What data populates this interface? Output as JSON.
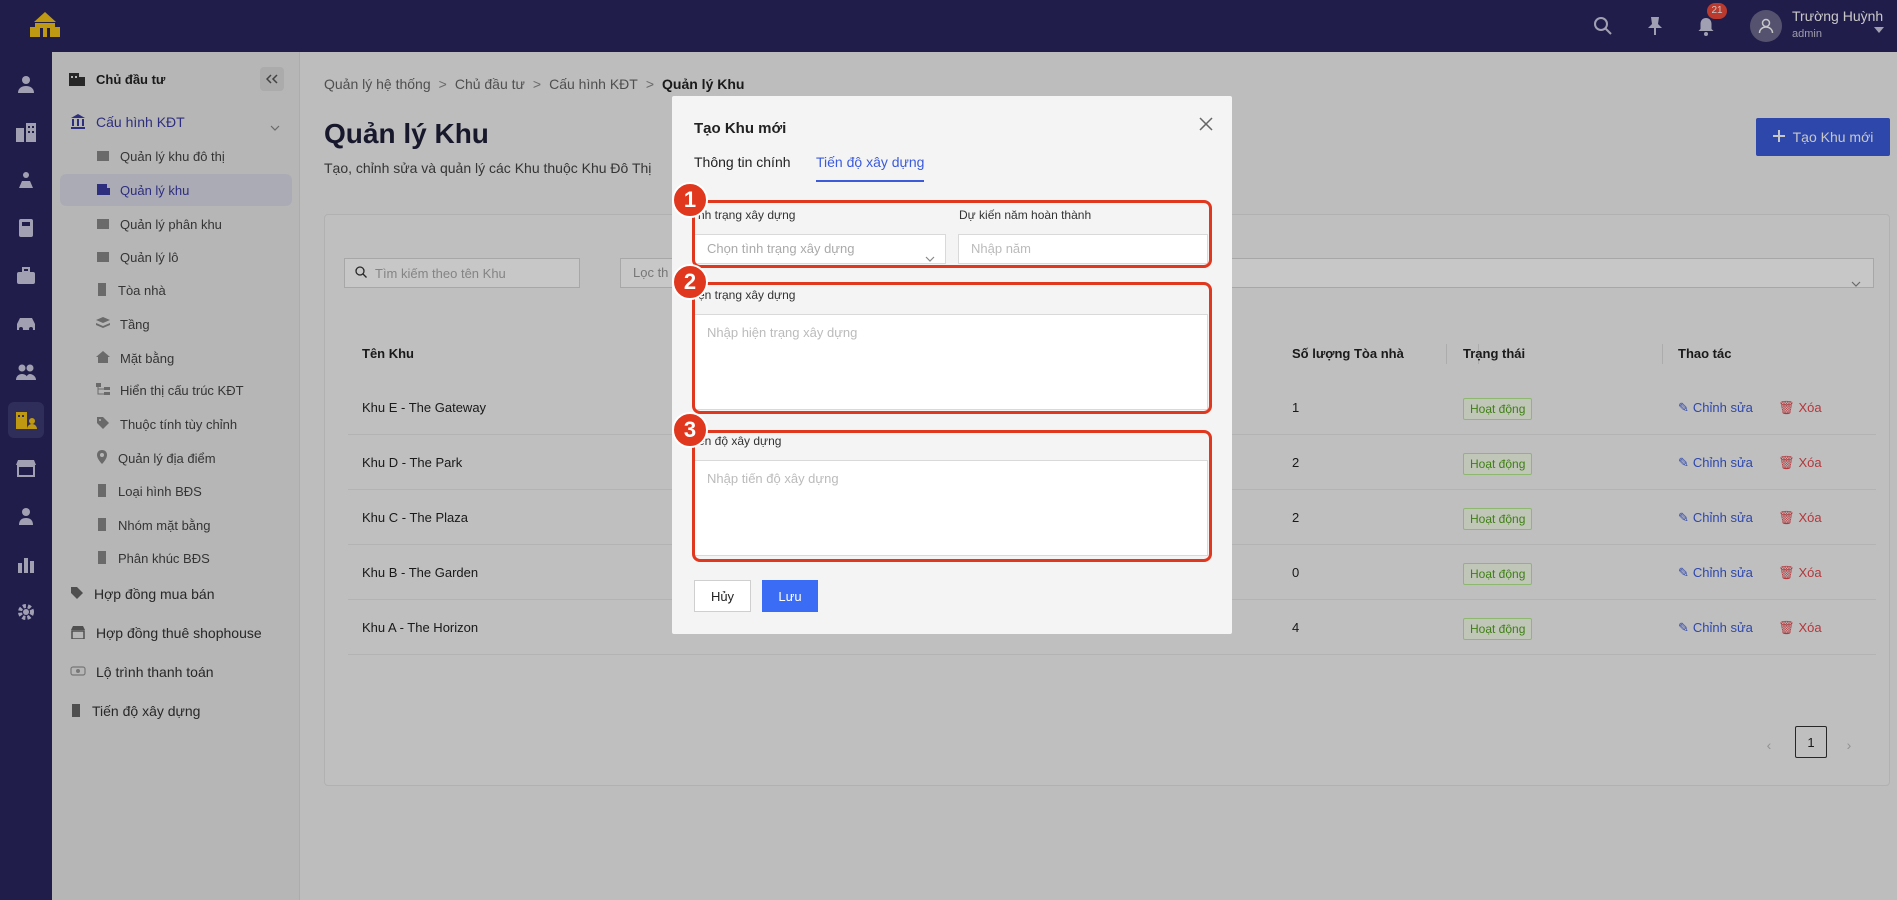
{
  "header": {
    "notification_count": "21",
    "user_name": "Trường Huỳnh",
    "user_role": "admin"
  },
  "sidebar": {
    "header_label": "Chủ đầu tư",
    "group_label": "Cấu hình KĐT",
    "sub_items": [
      {
        "label": "Quản lý khu đô thị",
        "icon": "building-icon"
      },
      {
        "label": "Quản lý khu",
        "icon": "building-area-icon",
        "active": true
      },
      {
        "label": "Quản lý phân khu",
        "icon": "building-icon"
      },
      {
        "label": "Quản lý lô",
        "icon": "building-icon"
      },
      {
        "label": "Tòa nhà",
        "icon": "tower-icon"
      },
      {
        "label": "Tầng",
        "icon": "layers-icon"
      },
      {
        "label": "Mặt bằng",
        "icon": "home-icon"
      },
      {
        "label": "Hiển thị cấu trúc KĐT",
        "icon": "tree-icon"
      },
      {
        "label": "Thuộc tính tùy chỉnh",
        "icon": "tag-icon"
      },
      {
        "label": "Quản lý địa điểm",
        "icon": "pin-icon"
      },
      {
        "label": "Loại hình BĐS",
        "icon": "tower-icon"
      },
      {
        "label": "Nhóm mặt bằng",
        "icon": "tower-icon"
      },
      {
        "label": "Phân khúc BĐS",
        "icon": "tower-icon"
      }
    ],
    "bottom_items": [
      {
        "label": "Hợp đồng mua bán",
        "icon": "tag-icon"
      },
      {
        "label": "Hợp đồng thuê shophouse",
        "icon": "shop-icon"
      },
      {
        "label": "Lộ trình thanh toán",
        "icon": "money-icon"
      },
      {
        "label": "Tiến độ xây dựng",
        "icon": "tower-icon"
      }
    ]
  },
  "breadcrumb": [
    "Quản lý hệ thống",
    "Chủ đầu tư",
    "Cấu hình KĐT",
    "Quản lý Khu"
  ],
  "page": {
    "title": "Quản lý Khu",
    "subtitle": "Tạo, chỉnh sửa và quản lý các Khu thuộc Khu Đô Thị",
    "create_button": "Tạo Khu mới",
    "search_placeholder": "Tìm kiếm theo tên Khu",
    "filter_placeholder": "Lọc th"
  },
  "table": {
    "columns": [
      "Tên Khu",
      "Số lượng Tòa nhà",
      "Trạng thái",
      "Thao tác"
    ],
    "rows": [
      {
        "name": "Khu E - The Gateway",
        "buildings": "1",
        "status": "Hoạt động"
      },
      {
        "name": "Khu D - The Park",
        "buildings": "2",
        "status": "Hoạt động"
      },
      {
        "name": "Khu C - The Plaza",
        "buildings": "2",
        "status": "Hoạt động"
      },
      {
        "name": "Khu B - The Garden",
        "buildings": "0",
        "status": "Hoạt động"
      },
      {
        "name": "Khu A - The Horizon",
        "buildings": "4",
        "status": "Hoạt động"
      }
    ],
    "edit_label": "Chỉnh sửa",
    "delete_label": "Xóa",
    "current_page": "1"
  },
  "modal": {
    "title": "Tạo Khu mới",
    "tabs": [
      "Thông tin chính",
      "Tiến độ xây dựng"
    ],
    "active_tab": 1,
    "fields": {
      "construction_status_label": "nh trạng xây dựng",
      "construction_status_placeholder": "Chọn tình trạng xây dựng",
      "expected_year_label": "Dự kiến năm hoàn thành",
      "expected_year_placeholder": "Nhập năm",
      "current_state_label": "ện trạng xây dựng",
      "current_state_placeholder": "Nhập hiện trạng xây dựng",
      "progress_label": "ến độ xây dựng",
      "progress_placeholder": "Nhập tiến độ xây dựng"
    },
    "cancel_label": "Hủy",
    "save_label": "Lưu"
  },
  "annotations": [
    "1",
    "2",
    "3"
  ],
  "colors": {
    "topbar": "#2b2660",
    "primary": "#3b5bdb",
    "highlight": "#e0381f",
    "logo": "#f5c518"
  }
}
